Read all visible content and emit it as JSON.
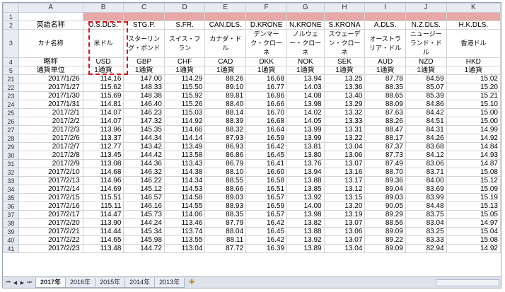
{
  "columns": [
    "A",
    "B",
    "C",
    "D",
    "E",
    "F",
    "G",
    "H",
    "I",
    "J",
    "K"
  ],
  "header_rows": {
    "row2": [
      "英語名称",
      "U.S.DLS.",
      "STG.P.",
      "S.FR.",
      "CAN.DLS.",
      "D.KRONE",
      "N.KRONE",
      "S.KRONA",
      "A.DLS.",
      "N.Z.DLS.",
      "H.K.DLS."
    ],
    "row3": [
      "カナ名称",
      "米ドル",
      "スターリング・ポンド",
      "スイス・フラン",
      "カナダ・ドル",
      "デンマーク・クローネ",
      "ノルウェー・クローネ",
      "スウェーデン・クローネ",
      "オーストラリア・ドル",
      "ニュージーランド・ドル",
      "香港ドル"
    ],
    "row4": [
      "略称",
      "USD",
      "GBP",
      "CHF",
      "CAD",
      "DKK",
      "NOK",
      "SEK",
      "AUD",
      "NZD",
      "HKD"
    ],
    "row5": [
      "通貨単位",
      "1通貨",
      "1通貨",
      "1通貨",
      "1通貨",
      "1通貨",
      "1通貨",
      "1通貨",
      "1通貨",
      "1通貨",
      "1通貨"
    ]
  },
  "rows": [
    {
      "n": "21",
      "date": "2017/1/26",
      "v": [
        "114.16",
        "147.00",
        "114.29",
        "88.26",
        "16.68",
        "13.94",
        "13.25",
        "87.78",
        "84.59",
        "15.02"
      ]
    },
    {
      "n": "22",
      "date": "2017/1/27",
      "v": [
        "115.62",
        "148.33",
        "115.50",
        "89.10",
        "16.77",
        "14.03",
        "13.36",
        "88.35",
        "85.07",
        "15.20"
      ]
    },
    {
      "n": "23",
      "date": "2017/1/30",
      "v": [
        "115.69",
        "148.38",
        "115.92",
        "89.81",
        "16.86",
        "14.08",
        "13.40",
        "88.65",
        "85.39",
        "15.21"
      ]
    },
    {
      "n": "24",
      "date": "2017/1/31",
      "v": [
        "114.81",
        "146.40",
        "115.26",
        "88.40",
        "16.66",
        "13.98",
        "13.29",
        "88.09",
        "84.86",
        "15.10"
      ]
    },
    {
      "n": "25",
      "date": "2017/2/1",
      "v": [
        "114.07",
        "146.23",
        "115.03",
        "88.14",
        "16.70",
        "14.02",
        "13.32",
        "87.63",
        "84.42",
        "15.00"
      ]
    },
    {
      "n": "26",
      "date": "2017/2/2",
      "v": [
        "114.07",
        "147.32",
        "114.92",
        "88.39",
        "16.68",
        "14.05",
        "13.33",
        "88.26",
        "84.51",
        "15.00"
      ]
    },
    {
      "n": "27",
      "date": "2017/2/3",
      "v": [
        "113.96",
        "145.35",
        "114.66",
        "88.32",
        "16.64",
        "13.99",
        "13.31",
        "88.47",
        "84.31",
        "14.99"
      ]
    },
    {
      "n": "28",
      "date": "2017/2/6",
      "v": [
        "113.37",
        "144.34",
        "114.14",
        "87.93",
        "16.59",
        "13.99",
        "13.22",
        "88.17",
        "84.26",
        "14.92"
      ]
    },
    {
      "n": "29",
      "date": "2017/2/7",
      "v": [
        "112.77",
        "143.42",
        "113.49",
        "86.93",
        "16.42",
        "13.81",
        "13.04",
        "87.37",
        "83.68",
        "14.84"
      ]
    },
    {
      "n": "30",
      "date": "2017/2/8",
      "v": [
        "113.45",
        "144.42",
        "113.58",
        "86.86",
        "16.45",
        "13.80",
        "13.06",
        "87.73",
        "84.12",
        "14.93"
      ]
    },
    {
      "n": "31",
      "date": "2017/2/9",
      "v": [
        "113.08",
        "144.36",
        "113.43",
        "86.79",
        "16.41",
        "13.76",
        "13.07",
        "87.49",
        "83.06",
        "14.87"
      ]
    },
    {
      "n": "32",
      "date": "2017/2/10",
      "v": [
        "114.68",
        "146.32",
        "114.38",
        "88.10",
        "16.60",
        "13.94",
        "13.16",
        "88.70",
        "83.71",
        "15.08"
      ]
    },
    {
      "n": "33",
      "date": "2017/2/13",
      "v": [
        "114.96",
        "146.22",
        "114.34",
        "88.55",
        "16.58",
        "13.88",
        "13.17",
        "89.36",
        "84.00",
        "15.12"
      ]
    },
    {
      "n": "34",
      "date": "2017/2/14",
      "v": [
        "114.69",
        "145.12",
        "114.53",
        "88.66",
        "16.51",
        "13.85",
        "13.12",
        "89.04",
        "83.69",
        "15.09"
      ]
    },
    {
      "n": "35",
      "date": "2017/2/15",
      "v": [
        "115.51",
        "146.57",
        "114.58",
        "89.03",
        "16.57",
        "13.92",
        "13.15",
        "89.03",
        "83.99",
        "15.19"
      ]
    },
    {
      "n": "36",
      "date": "2017/2/16",
      "v": [
        "115.11",
        "146.16",
        "114.55",
        "88.93",
        "16.59",
        "14.00",
        "13.20",
        "90.05",
        "84.48",
        "15.13"
      ]
    },
    {
      "n": "37",
      "date": "2017/2/17",
      "v": [
        "114.47",
        "145.73",
        "114.06",
        "88.35",
        "16.57",
        "13.98",
        "13.19",
        "89.29",
        "83.75",
        "15.05"
      ]
    },
    {
      "n": "38",
      "date": "2017/2/20",
      "v": [
        "113.90",
        "144.24",
        "113.46",
        "87.79",
        "16.42",
        "13.82",
        "13.07",
        "88.56",
        "83.04",
        "14.97"
      ]
    },
    {
      "n": "39",
      "date": "2017/2/21",
      "v": [
        "114.44",
        "145.34",
        "113.74",
        "88.04",
        "16.45",
        "13.88",
        "13.06",
        "89.09",
        "83.25",
        "15.04"
      ]
    },
    {
      "n": "40",
      "date": "2017/2/22",
      "v": [
        "114.65",
        "145.98",
        "113.55",
        "88.11",
        "16.42",
        "13.92",
        "13.07",
        "89.22",
        "83.33",
        "15.08"
      ]
    },
    {
      "n": "41",
      "date": "2017/2/23",
      "v": [
        "113.48",
        "144.72",
        "113.04",
        "87.72",
        "16.39",
        "13.89",
        "13.04",
        "89.09",
        "82.94",
        "14.92"
      ]
    }
  ],
  "sheet_tabs": [
    "2017年",
    "2016年",
    "2015年",
    "2014年",
    "2013年"
  ],
  "active_tab": "2017年",
  "colors": {
    "band": "#e8a8a8",
    "header_bg": "#e8ecf2",
    "highlight": "#e01010",
    "selected_col": "#c9d3e3"
  }
}
